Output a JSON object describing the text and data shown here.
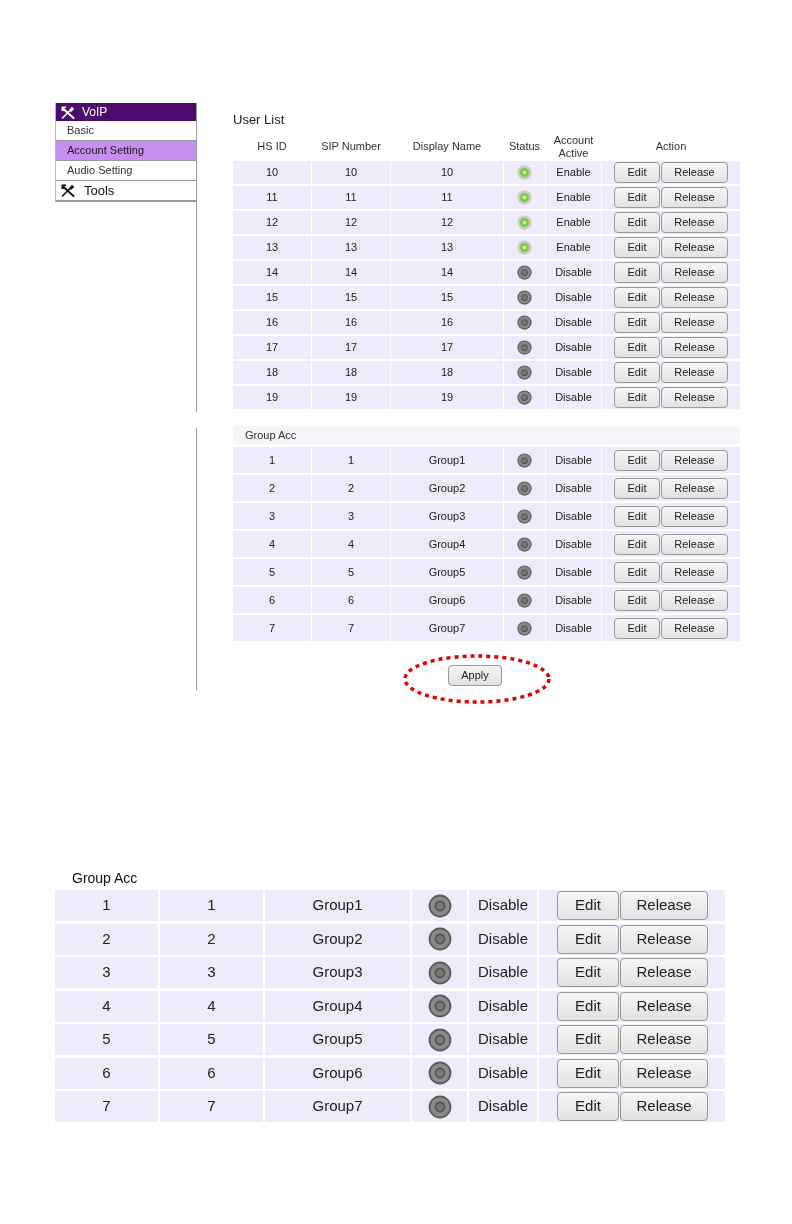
{
  "sidebar": {
    "sections": [
      {
        "title": "VoIP",
        "expanded": true,
        "items": [
          {
            "label": "Basic",
            "selected": false
          },
          {
            "label": "Account Setting",
            "selected": true
          },
          {
            "label": "Audio Setting",
            "selected": false
          }
        ]
      },
      {
        "title": "Tools",
        "expanded": false
      }
    ]
  },
  "user_list": {
    "title": "User List",
    "columns": [
      "HS ID",
      "SIP Number",
      "Display Name",
      "Status",
      "Account Active",
      "Action"
    ],
    "rows": [
      {
        "hs_id": "10",
        "sip_number": "10",
        "display_name": "10",
        "online": true,
        "account_active": "Enable",
        "actions": [
          "Edit",
          "Release"
        ]
      },
      {
        "hs_id": "11",
        "sip_number": "11",
        "display_name": "11",
        "online": true,
        "account_active": "Enable",
        "actions": [
          "Edit",
          "Release"
        ]
      },
      {
        "hs_id": "12",
        "sip_number": "12",
        "display_name": "12",
        "online": true,
        "account_active": "Enable",
        "actions": [
          "Edit",
          "Release"
        ]
      },
      {
        "hs_id": "13",
        "sip_number": "13",
        "display_name": "13",
        "online": true,
        "account_active": "Enable",
        "actions": [
          "Edit",
          "Release"
        ]
      },
      {
        "hs_id": "14",
        "sip_number": "14",
        "display_name": "14",
        "online": false,
        "account_active": "Disable",
        "actions": [
          "Edit",
          "Release"
        ]
      },
      {
        "hs_id": "15",
        "sip_number": "15",
        "display_name": "15",
        "online": false,
        "account_active": "Disable",
        "actions": [
          "Edit",
          "Release"
        ]
      },
      {
        "hs_id": "16",
        "sip_number": "16",
        "display_name": "16",
        "online": false,
        "account_active": "Disable",
        "actions": [
          "Edit",
          "Release"
        ]
      },
      {
        "hs_id": "17",
        "sip_number": "17",
        "display_name": "17",
        "online": false,
        "account_active": "Disable",
        "actions": [
          "Edit",
          "Release"
        ]
      },
      {
        "hs_id": "18",
        "sip_number": "18",
        "display_name": "18",
        "online": false,
        "account_active": "Disable",
        "actions": [
          "Edit",
          "Release"
        ]
      },
      {
        "hs_id": "19",
        "sip_number": "19",
        "display_name": "19",
        "online": false,
        "account_active": "Disable",
        "actions": [
          "Edit",
          "Release"
        ]
      }
    ]
  },
  "group_account": {
    "title": "Group Acc",
    "rows": [
      {
        "hs_id": "1",
        "sip_number": "1",
        "display_name": "Group1",
        "online": false,
        "account_active": "Disable",
        "actions": [
          "Edit",
          "Release"
        ]
      },
      {
        "hs_id": "2",
        "sip_number": "2",
        "display_name": "Group2",
        "online": false,
        "account_active": "Disable",
        "actions": [
          "Edit",
          "Release"
        ]
      },
      {
        "hs_id": "3",
        "sip_number": "3",
        "display_name": "Group3",
        "online": false,
        "account_active": "Disable",
        "actions": [
          "Edit",
          "Release"
        ]
      },
      {
        "hs_id": "4",
        "sip_number": "4",
        "display_name": "Group4",
        "online": false,
        "account_active": "Disable",
        "actions": [
          "Edit",
          "Release"
        ]
      },
      {
        "hs_id": "5",
        "sip_number": "5",
        "display_name": "Group5",
        "online": false,
        "account_active": "Disable",
        "actions": [
          "Edit",
          "Release"
        ]
      },
      {
        "hs_id": "6",
        "sip_number": "6",
        "display_name": "Group6",
        "online": false,
        "account_active": "Disable",
        "actions": [
          "Edit",
          "Release"
        ]
      },
      {
        "hs_id": "7",
        "sip_number": "7",
        "display_name": "Group7",
        "online": false,
        "account_active": "Disable",
        "actions": [
          "Edit",
          "Release"
        ]
      }
    ]
  },
  "apply_button": {
    "label": "Apply",
    "circled": true
  },
  "group_account_enlarged": {
    "title": "Group Acc",
    "rows": [
      {
        "hs_id": "1",
        "sip_number": "1",
        "display_name": "Group1",
        "online": false,
        "account_active": "Disable",
        "actions": [
          "Edit",
          "Release"
        ]
      },
      {
        "hs_id": "2",
        "sip_number": "2",
        "display_name": "Group2",
        "online": false,
        "account_active": "Disable",
        "actions": [
          "Edit",
          "Release"
        ]
      },
      {
        "hs_id": "3",
        "sip_number": "3",
        "display_name": "Group3",
        "online": false,
        "account_active": "Disable",
        "actions": [
          "Edit",
          "Release"
        ]
      },
      {
        "hs_id": "4",
        "sip_number": "4",
        "display_name": "Group4",
        "online": false,
        "account_active": "Disable",
        "actions": [
          "Edit",
          "Release"
        ]
      },
      {
        "hs_id": "5",
        "sip_number": "5",
        "display_name": "Group5",
        "online": false,
        "account_active": "Disable",
        "actions": [
          "Edit",
          "Release"
        ]
      },
      {
        "hs_id": "6",
        "sip_number": "6",
        "display_name": "Group6",
        "online": false,
        "account_active": "Disable",
        "actions": [
          "Edit",
          "Release"
        ]
      },
      {
        "hs_id": "7",
        "sip_number": "7",
        "display_name": "Group7",
        "online": false,
        "account_active": "Disable",
        "actions": [
          "Edit",
          "Release"
        ]
      }
    ]
  }
}
